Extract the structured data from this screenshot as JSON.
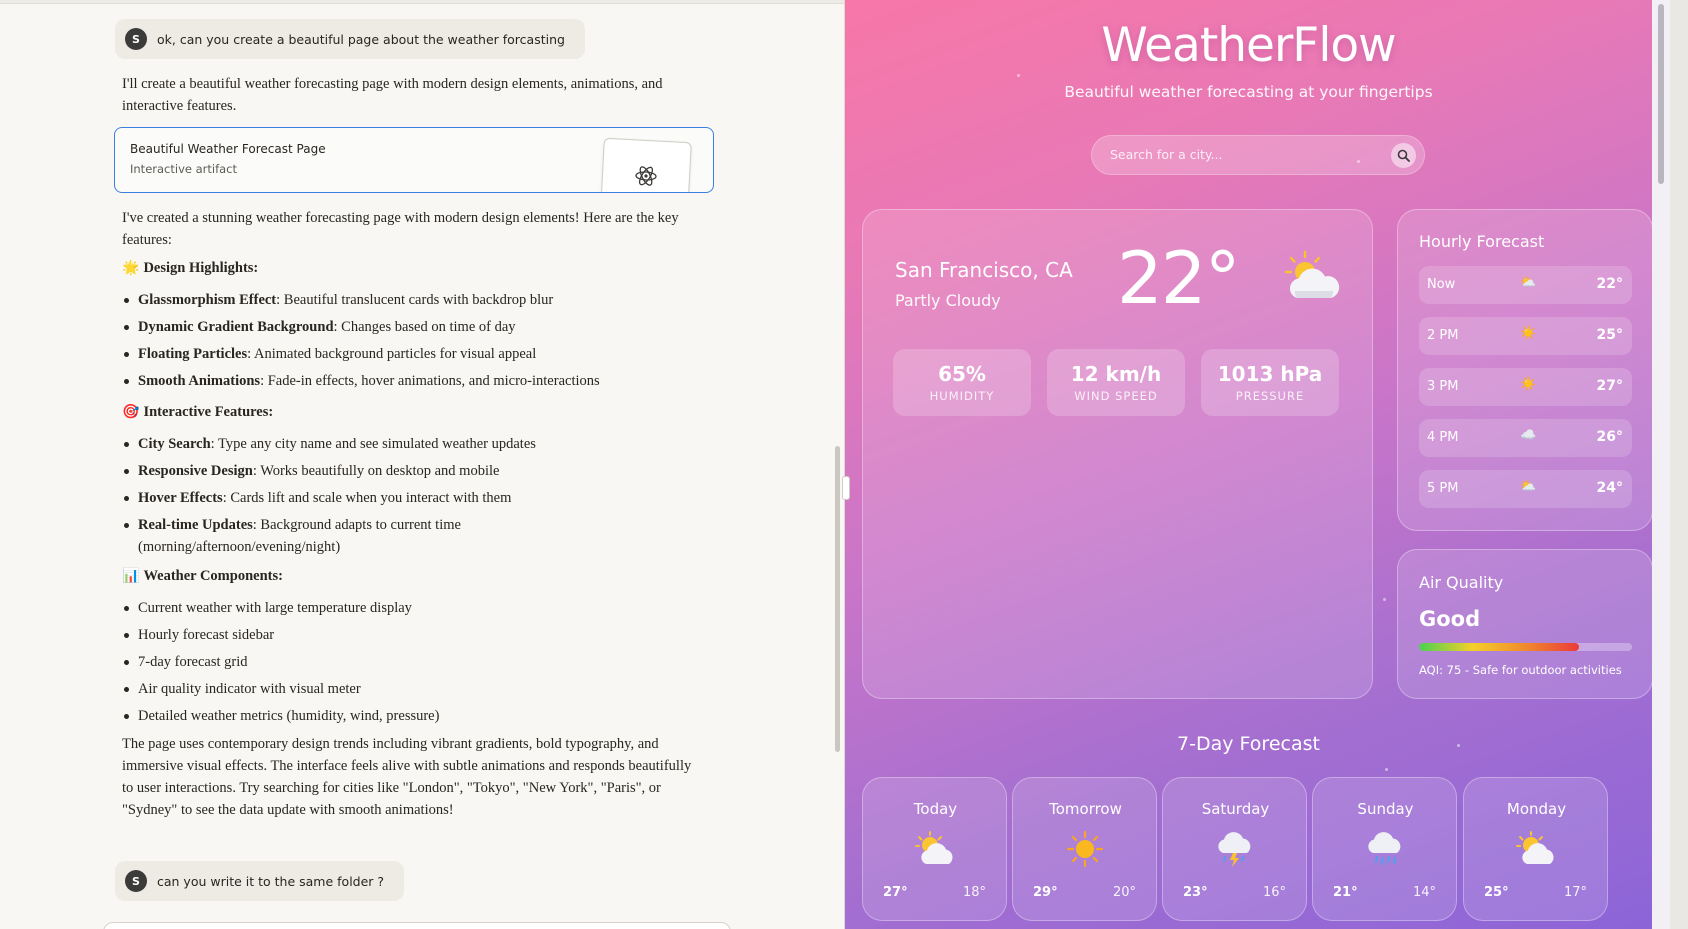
{
  "chat": {
    "user_initial": "S",
    "msg1": "ok, can you create a beautiful page about the weather forcasting",
    "intro": "I'll create a beautiful weather forecasting page with modern design elements, animations, and interactive features.",
    "artifact": {
      "title": "Beautiful Weather Forecast Page",
      "subtitle": "Interactive artifact"
    },
    "summary": "I've created a stunning weather forecasting page with modern design elements! Here are the key features:",
    "sections": [
      {
        "emoji": "🌟",
        "title": "Design Highlights:",
        "items": [
          {
            "bold": "Glassmorphism Effect",
            "text": ": Beautiful translucent cards with backdrop blur"
          },
          {
            "bold": "Dynamic Gradient Background",
            "text": ": Changes based on time of day"
          },
          {
            "bold": "Floating Particles",
            "text": ": Animated background particles for visual appeal"
          },
          {
            "bold": "Smooth Animations",
            "text": ": Fade-in effects, hover animations, and micro-interactions"
          }
        ]
      },
      {
        "emoji": "🎯",
        "title": "Interactive Features:",
        "items": [
          {
            "bold": "City Search",
            "text": ": Type any city name and see simulated weather updates"
          },
          {
            "bold": "Responsive Design",
            "text": ": Works beautifully on desktop and mobile"
          },
          {
            "bold": "Hover Effects",
            "text": ": Cards lift and scale when you interact with them"
          },
          {
            "bold": "Real-time Updates",
            "text": ": Background adapts to current time (morning/afternoon/evening/night)"
          }
        ]
      },
      {
        "emoji": "📊",
        "title": "Weather Components:",
        "items": [
          {
            "bold": "",
            "text": "Current weather with large temperature display"
          },
          {
            "bold": "",
            "text": "Hourly forecast sidebar"
          },
          {
            "bold": "",
            "text": "7-day forecast grid"
          },
          {
            "bold": "",
            "text": "Air quality indicator with visual meter"
          },
          {
            "bold": "",
            "text": "Detailed weather metrics (humidity, wind, pressure)"
          }
        ]
      }
    ],
    "closing": "The page uses contemporary design trends including vibrant gradients, bold typography, and immersive visual effects. The interface feels alive with subtle animations and responds beautifully to user interactions. Try searching for cities like \"London\", \"Tokyo\", \"New York\", \"Paris\", or \"Sydney\" to see the data update with smooth animations!",
    "msg2": "can you write it to the same folder ?"
  },
  "weather": {
    "title": "WeatherFlow",
    "subtitle": "Beautiful weather forecasting at your fingertips",
    "search_placeholder": "Search for a city...",
    "current": {
      "city": "San Francisco, CA",
      "condition": "Partly Cloudy",
      "temp": "22°",
      "icon": "partly-cloudy",
      "stats": [
        {
          "value": "65%",
          "label": "HUMIDITY"
        },
        {
          "value": "12 km/h",
          "label": "WIND SPEED"
        },
        {
          "value": "1013 hPa",
          "label": "PRESSURE"
        }
      ]
    },
    "hourly": {
      "title": "Hourly Forecast",
      "rows": [
        {
          "time": "Now",
          "icon": "partly-cloudy",
          "temp": "22°"
        },
        {
          "time": "2 PM",
          "icon": "sunny",
          "temp": "25°"
        },
        {
          "time": "3 PM",
          "icon": "sunny",
          "temp": "27°"
        },
        {
          "time": "4 PM",
          "icon": "cloudy",
          "temp": "26°"
        },
        {
          "time": "5 PM",
          "icon": "partly-cloudy",
          "temp": "24°"
        }
      ]
    },
    "air_quality": {
      "title": "Air Quality",
      "rating": "Good",
      "level": 0.75,
      "note": "AQI: 75 - Safe for outdoor activities"
    },
    "seven_day": {
      "title": "7-Day Forecast",
      "days": [
        {
          "name": "Today",
          "icon": "partly-cloudy",
          "hi": "27°",
          "lo": "18°"
        },
        {
          "name": "Tomorrow",
          "icon": "sunny",
          "hi": "29°",
          "lo": "20°"
        },
        {
          "name": "Saturday",
          "icon": "thunderstorm",
          "hi": "23°",
          "lo": "16°"
        },
        {
          "name": "Sunday",
          "icon": "rain",
          "hi": "21°",
          "lo": "14°"
        },
        {
          "name": "Monday",
          "icon": "partly-cloudy",
          "hi": "25°",
          "lo": "17°"
        }
      ]
    },
    "colors": {
      "gradient_start": "#f777a8",
      "gradient_end": "#8c64d8",
      "accent_blue": "#3b7fe0"
    }
  }
}
